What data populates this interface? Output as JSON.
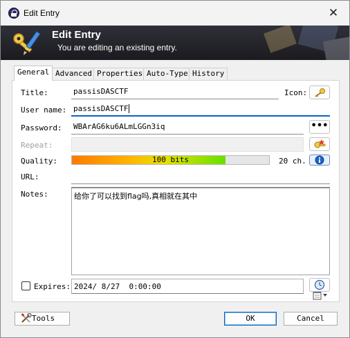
{
  "window": {
    "title": "Edit Entry",
    "close_glyph": "✕"
  },
  "banner": {
    "title": "Edit Entry",
    "subtitle": "You are editing an existing entry."
  },
  "tabs": [
    {
      "label": "General",
      "active": true
    },
    {
      "label": "Advanced",
      "active": false
    },
    {
      "label": "Properties",
      "active": false
    },
    {
      "label": "Auto-Type",
      "active": false
    },
    {
      "label": "History",
      "active": false
    }
  ],
  "form": {
    "title_label": "Title:",
    "title_value": "passisDASCTF",
    "icon_label": "Icon:",
    "username_label": "User name:",
    "username_value": "passisDASCTF",
    "password_label": "Password:",
    "password_value": "WBArAG6ku6ALmLGGn3iq",
    "repeat_label": "Repeat:",
    "repeat_value": "",
    "quality_label": "Quality:",
    "quality_text": "100 bits",
    "quality_fraction": 0.78,
    "quality_chars": "20 ch.",
    "url_label": "URL:",
    "url_value": "",
    "notes_label": "Notes:",
    "notes_value": "给你了可以找到flag吗,真相就在其中",
    "expires_label": "Expires:",
    "expires_checked": false,
    "expires_value": "2024/ 8/27  0:00:00"
  },
  "buttons": {
    "tools": "Tools",
    "ok": "OK",
    "cancel": "Cancel",
    "show_password": "•••"
  },
  "icons": {
    "title": "keepass-lock-icon",
    "banner": "key-pencil-icon",
    "entry_icon": "key-icon",
    "generator": "password-generator-icon",
    "quality_info": "info-icon",
    "calendar": "calendar-icon",
    "expiry_presets": "clock-icon",
    "tools": "tools-icon"
  },
  "colors": {
    "banner_bg": "#26262c",
    "focus_blue": "#0a64c0",
    "quality_start": "#ff7a00",
    "quality_end": "#66e000"
  }
}
